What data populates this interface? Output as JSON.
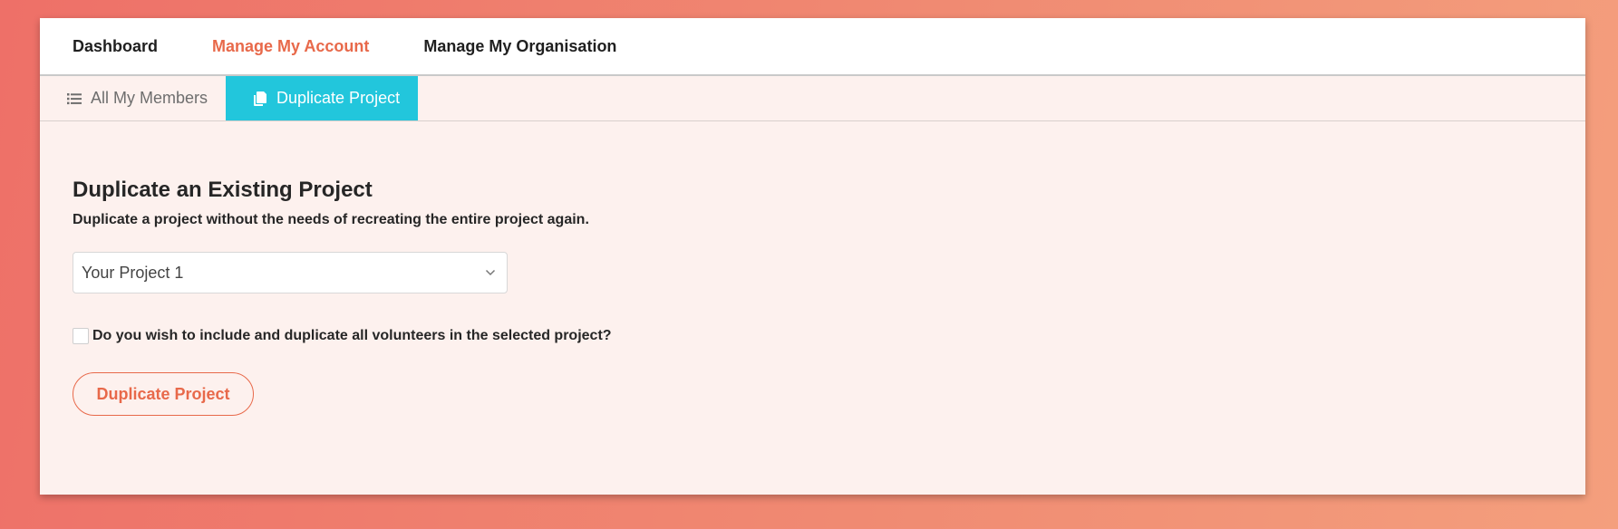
{
  "topnav": {
    "items": [
      {
        "label": "Dashboard"
      },
      {
        "label": "Manage My Account"
      },
      {
        "label": "Manage My Organisation"
      }
    ],
    "active_index": 1,
    "accent_color": "#e8694a"
  },
  "subnav": {
    "tabs": [
      {
        "label": "All My Members",
        "icon": "list-icon"
      },
      {
        "label": "Duplicate Project",
        "icon": "copy-icon"
      }
    ],
    "active_index": 1,
    "active_color": "#22c6dc"
  },
  "main": {
    "title": "Duplicate an Existing Project",
    "subtitle": "Duplicate a project without the needs of recreating the entire project again.",
    "project_select": {
      "selected": "Your Project 1",
      "icon": "chevron-down-icon"
    },
    "include_volunteers": {
      "label": "Do you wish to include and duplicate all volunteers in the selected project?",
      "checked": false
    },
    "submit_label": "Duplicate Project"
  }
}
